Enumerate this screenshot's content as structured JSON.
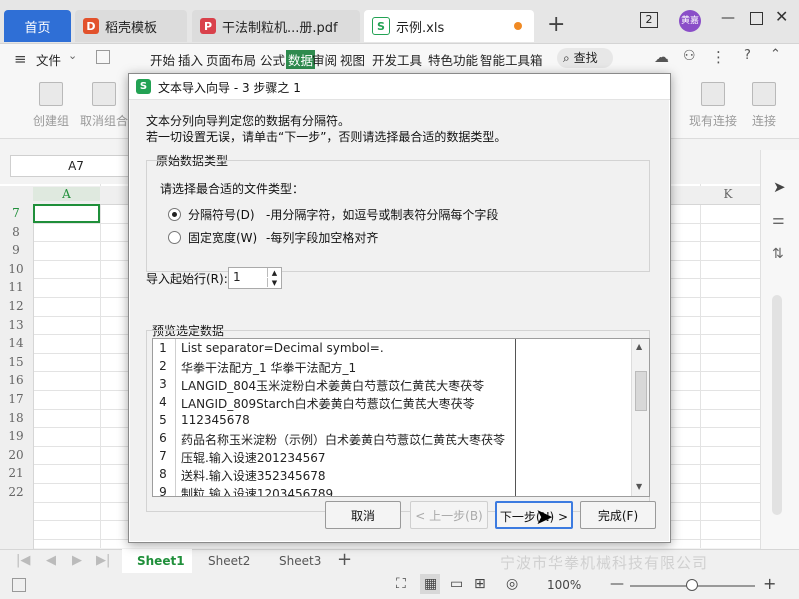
{
  "tabs": {
    "home": "首页",
    "template": "稻壳模板",
    "pdf": "干法制粒机...册.pdf",
    "xls": "示例.xls",
    "window_count": "2",
    "user": "黄嘉"
  },
  "menu": {
    "file": "文件",
    "items": [
      "开始",
      "插入",
      "页面布局",
      "公式",
      "数据",
      "审阅",
      "视图",
      "开发工具",
      "特色功能",
      "智能工具箱"
    ],
    "search": "查找"
  },
  "toolbar": {
    "left": [
      "创建组",
      "取消组合"
    ],
    "right": [
      "现有连接",
      "连接"
    ]
  },
  "formula": {
    "namebox": "A7"
  },
  "sheet": {
    "col_a": "A",
    "col_k": "K",
    "rows": [
      "7",
      "8",
      "9",
      "10",
      "11",
      "12",
      "13",
      "14",
      "15",
      "16",
      "17",
      "18",
      "19",
      "20",
      "21",
      "22"
    ]
  },
  "sheet_tabs": [
    "Sheet1",
    "Sheet2",
    "Sheet3"
  ],
  "status": {
    "zoom": "100%"
  },
  "dialog": {
    "title": "文本导入向导 - 3 步骤之 1",
    "desc1": "文本分列向导判定您的数据有分隔符。",
    "desc2": "若一切设置无误，请单击“下一步”，否则请选择最合适的数据类型。",
    "group_label": "原始数据类型",
    "choose_label": "请选择最合适的文件类型：",
    "opt_delim": "分隔符号(D)",
    "opt_delim_desc": "-用分隔字符，如逗号或制表符分隔每个字段",
    "opt_fixed": "固定宽度(W)",
    "opt_fixed_desc": "-每列字段加空格对齐",
    "start_row_label": "导入起始行(R):",
    "start_row_value": "1",
    "preview_label": "预览选定数据",
    "preview_rows": [
      {
        "n": "1",
        "t": "List separator=Decimal symbol=."
      },
      {
        "n": "2",
        "t": "华拳干法配方_1 华拳干法配方_1"
      },
      {
        "n": "3",
        "t": "LANGID_804玉米淀粉白术姜黄白芍薏苡仁黄芪大枣茯苓"
      },
      {
        "n": "4",
        "t": "LANGID_809Starch白术姜黄白芍薏苡仁黄芪大枣茯苓"
      },
      {
        "n": "5",
        "t": "112345678"
      },
      {
        "n": "6",
        "t": "药品名称玉米淀粉（示例）白术姜黄白芍薏苡仁黄芪大枣茯苓"
      },
      {
        "n": "7",
        "t": "压辊.输入设速201234567"
      },
      {
        "n": "8",
        "t": "送料.输入设速352345678"
      },
      {
        "n": "9",
        "t": "制粒.输入设速1203456789"
      }
    ],
    "btn_cancel": "取消",
    "btn_prev": "< 上一步(B)",
    "btn_next": "下一步(N) >",
    "btn_finish": "完成(F)"
  },
  "watermark": "宁波市华拳机械科技有限公司"
}
